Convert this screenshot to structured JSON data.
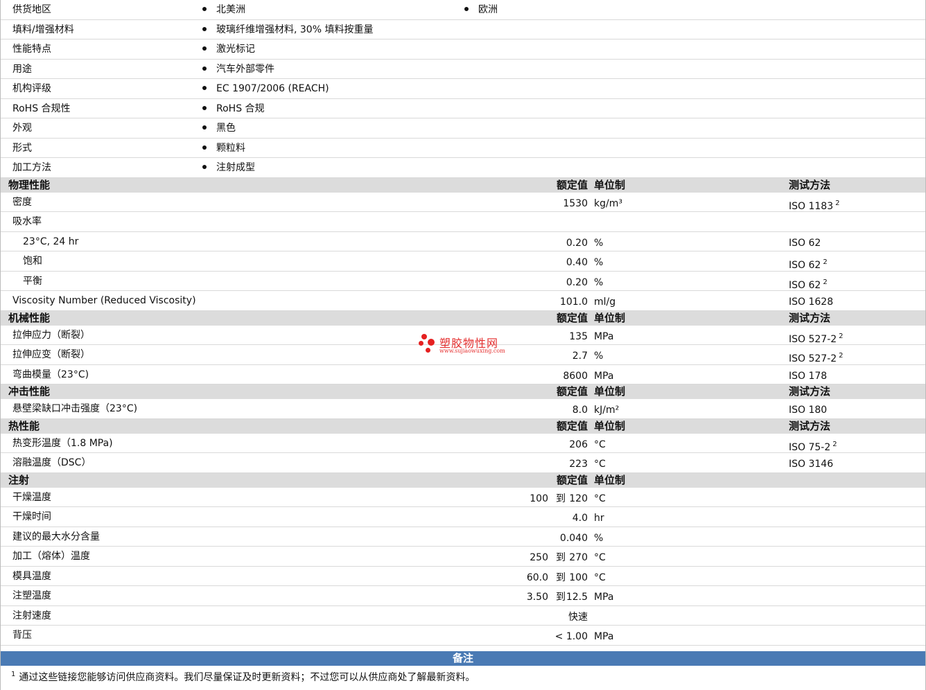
{
  "info": [
    {
      "label": "供货地区",
      "values": [
        "北美洲",
        "欧洲"
      ]
    },
    {
      "label": "填料/增强材料",
      "values": [
        "玻璃纤维增强材料, 30% 填料按重量"
      ]
    },
    {
      "label": "性能特点",
      "values": [
        "激光标记"
      ]
    },
    {
      "label": "用途",
      "values": [
        "汽车外部零件"
      ]
    },
    {
      "label": "机构评级",
      "values": [
        "EC 1907/2006 (REACH)"
      ]
    },
    {
      "label": "RoHS 合规性",
      "values": [
        "RoHS 合规"
      ]
    },
    {
      "label": "外观",
      "values": [
        "黑色"
      ]
    },
    {
      "label": "形式",
      "values": [
        "颗粒料"
      ]
    },
    {
      "label": "加工方法",
      "values": [
        "注射成型"
      ]
    }
  ],
  "columns": {
    "value": "额定值",
    "unit": "单位制",
    "method": "测试方法"
  },
  "sections": [
    {
      "title": "物理性能",
      "show_method": true,
      "rows": [
        {
          "label": "密度",
          "value": "1530",
          "unit": "kg/m³",
          "method": "ISO 1183",
          "sup": "2"
        },
        {
          "label": "吸水率",
          "value": "",
          "unit": "",
          "method": "",
          "sup": ""
        },
        {
          "label": "23°C, 24 hr",
          "sub": true,
          "value": "0.20",
          "unit": "%",
          "method": "ISO 62",
          "sup": ""
        },
        {
          "label": "饱和",
          "sub": true,
          "value": "0.40",
          "unit": "%",
          "method": "ISO 62",
          "sup": "2"
        },
        {
          "label": "平衡",
          "sub": true,
          "value": "0.20",
          "unit": "%",
          "method": "ISO 62",
          "sup": "2"
        },
        {
          "label": "Viscosity Number (Reduced Viscosity)",
          "value": "101.0",
          "unit": "ml/g",
          "method": "ISO 1628",
          "sup": ""
        }
      ]
    },
    {
      "title": "机械性能",
      "show_method": true,
      "rows": [
        {
          "label": "拉伸应力（断裂）",
          "value": "135",
          "unit": "MPa",
          "method": "ISO 527-2",
          "sup": "2"
        },
        {
          "label": "拉伸应变（断裂）",
          "value": "2.7",
          "unit": "%",
          "method": "ISO 527-2",
          "sup": "2"
        },
        {
          "label": "弯曲模量（23°C)",
          "value": "8600",
          "unit": "MPa",
          "method": "ISO 178",
          "sup": ""
        }
      ]
    },
    {
      "title": "冲击性能",
      "show_method": true,
      "rows": [
        {
          "label": "悬壁梁缺口冲击强度（23°C)",
          "value": "8.0",
          "unit": "kJ/m²",
          "method": "ISO 180",
          "sup": ""
        }
      ]
    },
    {
      "title": "热性能",
      "show_method": true,
      "rows": [
        {
          "label": "热变形温度（1.8 MPa)",
          "value": "206",
          "unit": "°C",
          "method": "ISO 75-2",
          "sup": "2"
        },
        {
          "label": "溶融温度（DSC）",
          "value": "223",
          "unit": "°C",
          "method": "ISO 3146",
          "sup": ""
        }
      ]
    },
    {
      "title": "注射",
      "show_method": false,
      "rows": [
        {
          "label": "干燥温度",
          "range": [
            "100",
            "到",
            "120"
          ],
          "unit": "°C"
        },
        {
          "label": "干燥时间",
          "value": "4.0",
          "unit": "hr"
        },
        {
          "label": "建议的最大水分含量",
          "value": "0.040",
          "unit": "%"
        },
        {
          "label": "加工（熔体）温度",
          "range": [
            "250",
            "到",
            "270"
          ],
          "unit": "°C"
        },
        {
          "label": "模具温度",
          "range": [
            "60.0",
            "到",
            "100"
          ],
          "unit": "°C"
        },
        {
          "label": "注塑温度",
          "range": [
            "3.50",
            "到",
            "12.5"
          ],
          "unit": "MPa"
        },
        {
          "label": "注射速度",
          "value": "快速",
          "unit": ""
        },
        {
          "label": "背压",
          "value": "< 1.00",
          "unit": "MPa"
        }
      ]
    }
  ],
  "notes": {
    "title": "备注",
    "footnote_mark": "1",
    "footnote": "通过这些链接您能够访问供应商资料。我们尽量保证及时更新资料；不过您可以从供应商处了解最新资料。"
  },
  "watermark": {
    "name": "塑胶物性网",
    "url": "www.sujiaowuxing.com",
    "color": "#e52020"
  },
  "colors": {
    "header_bg": "#dcdcdc",
    "notes_bar": "#4a7ab4"
  }
}
